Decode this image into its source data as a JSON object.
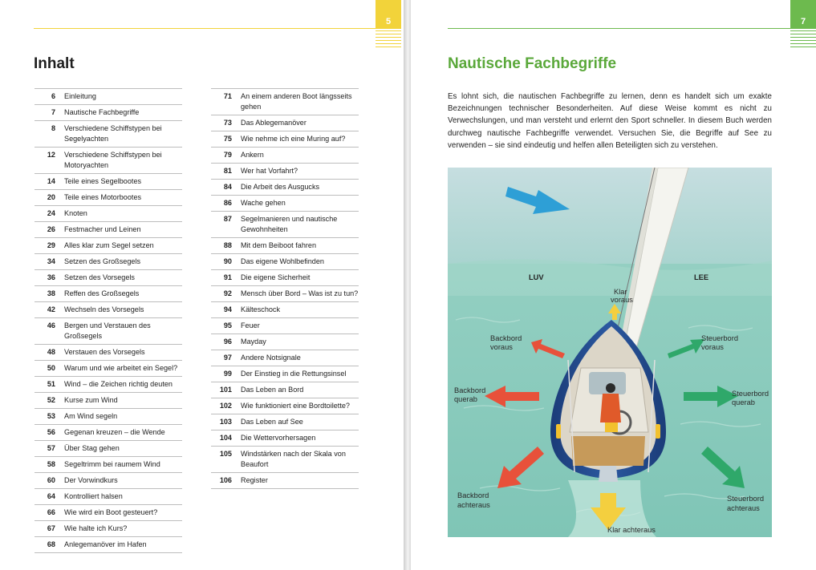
{
  "left_page": {
    "page_number": "5",
    "heading": "Inhalt",
    "toc_col1": [
      {
        "num": "6",
        "title": "Einleitung"
      },
      {
        "num": "7",
        "title": "Nautische Fachbegriffe"
      },
      {
        "num": "8",
        "title": "Verschiedene Schiffstypen bei Segelyachten"
      },
      {
        "num": "12",
        "title": "Verschiedene Schiffstypen bei Motoryachten"
      },
      {
        "num": "14",
        "title": "Teile eines Segelbootes"
      },
      {
        "num": "20",
        "title": "Teile eines Motorbootes"
      },
      {
        "num": "24",
        "title": "Knoten"
      },
      {
        "num": "26",
        "title": "Festmacher und Leinen"
      },
      {
        "num": "29",
        "title": "Alles klar zum Segel setzen"
      },
      {
        "num": "34",
        "title": "Setzen des Großsegels"
      },
      {
        "num": "36",
        "title": "Setzen des Vorsegels"
      },
      {
        "num": "38",
        "title": "Reffen des Großsegels"
      },
      {
        "num": "42",
        "title": "Wechseln des Vorsegels"
      },
      {
        "num": "46",
        "title": "Bergen und Verstauen des Großsegels"
      },
      {
        "num": "48",
        "title": "Verstauen des Vorsegels"
      },
      {
        "num": "50",
        "title": "Warum und wie arbeitet ein Segel?"
      },
      {
        "num": "51",
        "title": "Wind – die Zeichen richtig deuten"
      },
      {
        "num": "52",
        "title": "Kurse zum Wind"
      },
      {
        "num": "53",
        "title": "Am Wind segeln"
      },
      {
        "num": "56",
        "title": "Gegenan kreuzen – die Wende"
      },
      {
        "num": "57",
        "title": "Über Stag gehen"
      },
      {
        "num": "58",
        "title": "Segeltrimm bei raumem Wind"
      },
      {
        "num": "60",
        "title": "Der Vorwindkurs"
      },
      {
        "num": "64",
        "title": "Kontrolliert halsen"
      },
      {
        "num": "66",
        "title": "Wie wird ein Boot gesteuert?"
      },
      {
        "num": "67",
        "title": "Wie halte ich Kurs?"
      },
      {
        "num": "68",
        "title": "Anlegemanöver im Hafen"
      }
    ],
    "toc_col2": [
      {
        "num": "71",
        "title": "An einem anderen Boot längsseits gehen"
      },
      {
        "num": "73",
        "title": "Das Ablegemanöver"
      },
      {
        "num": "75",
        "title": "Wie nehme ich eine Muring auf?"
      },
      {
        "num": "79",
        "title": "Ankern"
      },
      {
        "num": "81",
        "title": "Wer hat Vorfahrt?"
      },
      {
        "num": "84",
        "title": "Die Arbeit des Ausgucks"
      },
      {
        "num": "86",
        "title": "Wache gehen"
      },
      {
        "num": "87",
        "title": "Segelmanieren und nautische Gewohnheiten"
      },
      {
        "num": "88",
        "title": "Mit dem Beiboot fahren"
      },
      {
        "num": "90",
        "title": "Das eigene Wohlbefinden"
      },
      {
        "num": "91",
        "title": "Die eigene Sicherheit"
      },
      {
        "num": "92",
        "title": "Mensch über Bord – Was ist zu tun?"
      },
      {
        "num": "94",
        "title": "Kälteschock"
      },
      {
        "num": "95",
        "title": "Feuer"
      },
      {
        "num": "96",
        "title": "Mayday"
      },
      {
        "num": "97",
        "title": "Andere Notsignale"
      },
      {
        "num": "99",
        "title": "Der Einstieg in die Rettungsinsel"
      },
      {
        "num": "101",
        "title": "Das Leben an Bord"
      },
      {
        "num": "102",
        "title": "Wie funktioniert eine Bordtoilette?"
      },
      {
        "num": "103",
        "title": "Das Leben auf See"
      },
      {
        "num": "104",
        "title": "Die Wettervorhersagen"
      },
      {
        "num": "105",
        "title": "Windstärken nach der Skala von Beaufort"
      },
      {
        "num": "106",
        "title": "Register"
      }
    ]
  },
  "right_page": {
    "page_number": "7",
    "heading": "Nautische Fachbegriffe",
    "intro": "Es lohnt sich, die nautischen Fachbegriffe zu lernen, denn es handelt sich um exakte Bezeichnungen technischer Besonderheiten. Auf diese Weise kommt es nicht zu Verwechslungen, und man versteht und erlernt den Sport schneller. In diesem Buch werden durchweg nautische Fachbegriffe verwendet. Versuchen Sie, die Begriffe auf See zu verwenden – sie sind eindeutig und helfen allen Beteiligten sich zu verstehen.",
    "diagram": {
      "luv": "LUV",
      "lee": "LEE",
      "klar_voraus": [
        "Klar",
        "voraus"
      ],
      "backbord_voraus": [
        "Backbord",
        "voraus"
      ],
      "steuerbord_voraus": [
        "Steuerbord",
        "voraus"
      ],
      "backbord_querab": [
        "Backbord",
        "querab"
      ],
      "steuerbord_querab": [
        "Steuerbord",
        "querab"
      ],
      "backbord_achteraus": [
        "Backbord",
        "achteraus"
      ],
      "steuerbord_achteraus": [
        "Steuerbord",
        "achteraus"
      ],
      "klar_achteraus": "Klar achteraus"
    }
  },
  "colors": {
    "left_accent": "#f2d33a",
    "right_accent": "#6dba4e",
    "heading_green": "#5aa83a",
    "sea": "#8ecdbb",
    "red_arrow": "#e8513a",
    "green_arrow": "#2fa86a",
    "yellow_arrow": "#f4cf3f",
    "wind_arrow": "#2e9fd6"
  }
}
